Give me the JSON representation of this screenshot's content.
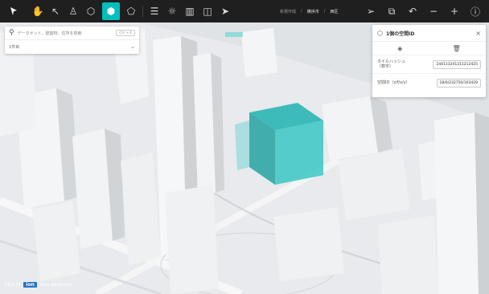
{
  "toolbar": {
    "tools": [
      "select-pointer",
      "hand-pan",
      "cursor-select",
      "person-pin",
      "box-tool",
      "spatial-id-tool",
      "polygon-tool",
      "layers-filter",
      "sun-shadow",
      "map-view",
      "split-view",
      "send-share"
    ],
    "breadcrumbs": [
      "新規作成",
      "横浜市",
      "西区"
    ],
    "right_icons": [
      "send-icon",
      "screenshot-icon",
      "undo-icon",
      "minus-icon",
      "plus-icon",
      "info-icon"
    ]
  },
  "search": {
    "placeholder": "データセット、建築物、住所を検索",
    "shortcut": "Ctrl + K",
    "area": "1件目"
  },
  "panel": {
    "title": "1個の空間ID",
    "rows": [
      {
        "label": "タイルハッシュ（数字）",
        "value": "244113241211212425"
      },
      {
        "label": "空間ID（z/f/x/y）",
        "value": "18/0/232750/103429"
      }
    ]
  },
  "credits": {
    "logo_text": "CESIUM",
    "ion": "ion",
    "data": "Data Attribution"
  },
  "colors": {
    "accent": "#00bebe",
    "toolbar_bg": "#1f1f1f",
    "voxel": "#1fb3b0"
  }
}
